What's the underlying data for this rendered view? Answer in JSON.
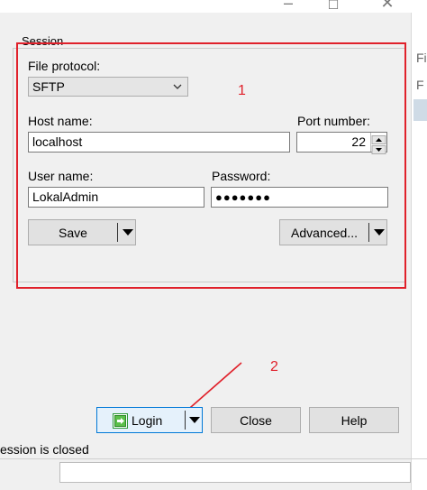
{
  "session": {
    "group_title": "Session",
    "file_protocol_label": "File protocol:",
    "file_protocol_value": "SFTP",
    "host_name_label": "Host name:",
    "host_name_value": "localhost",
    "port_label": "Port number:",
    "port_value": "22",
    "user_name_label": "User name:",
    "user_name_value": "LokalAdmin",
    "password_label": "Password:",
    "password_value": "●●●●●●●",
    "save_label": "Save",
    "advanced_label": "Advanced..."
  },
  "buttons": {
    "login_label": "Login",
    "close_label": "Close",
    "help_label": "Help"
  },
  "status": {
    "text": "ession is closed"
  },
  "right_panel": {
    "text1": "Fi",
    "text2": "F"
  },
  "annotations": {
    "marker1": "1",
    "marker2": "2"
  },
  "colors": {
    "annotation_red": "#e0212b",
    "login_border": "#0078d7"
  }
}
